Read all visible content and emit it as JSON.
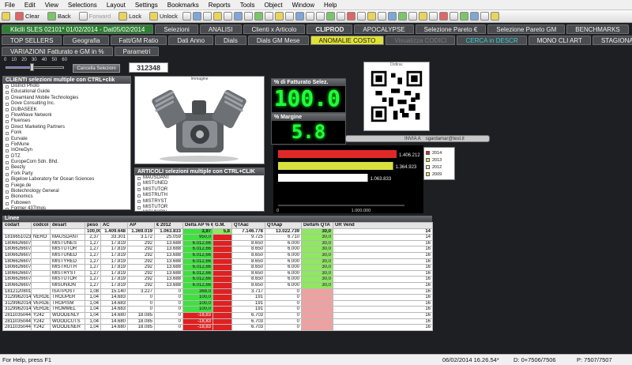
{
  "menu": [
    "File",
    "Edit",
    "View",
    "Selections",
    "Layout",
    "Settings",
    "Bookmarks",
    "Reports",
    "Tools",
    "Object",
    "Window",
    "Help"
  ],
  "toolbar": {
    "clear": "Clear",
    "back": "Back",
    "forward": "Forward",
    "lock": "Lock",
    "unlock": "Unlock"
  },
  "tabs_row1": [
    {
      "label": "Kliclli SLES 02101* 01/02/2014 - Dat05/02/2014",
      "style": "green"
    },
    {
      "label": "Selezioni",
      "style": ""
    },
    {
      "label": "ANALISI",
      "style": ""
    },
    {
      "label": "Clienti x Articolo",
      "style": ""
    },
    {
      "label": "CLIPROD",
      "style": "bold"
    },
    {
      "label": "APOCALYPSE",
      "style": ""
    },
    {
      "label": "Selezione Pareto €",
      "style": ""
    },
    {
      "label": "Selezione Pareto GM",
      "style": ""
    },
    {
      "label": "BENCHMARKS",
      "style": ""
    }
  ],
  "tabs_row2": [
    {
      "label": "TOP SELLERS",
      "style": ""
    },
    {
      "label": "Geografia",
      "style": ""
    },
    {
      "label": "Fatt/GM Ratio",
      "style": ""
    },
    {
      "label": "Dati Anno",
      "style": ""
    },
    {
      "label": "Dials",
      "style": ""
    },
    {
      "label": "Dials GM Mese",
      "style": ""
    },
    {
      "label": "ANOMALIE COSTO",
      "style": "yellow"
    },
    {
      "label": "Visualizza CODICI",
      "style": "dimtxt"
    },
    {
      "label": "CERCA in DESCR",
      "style": "cyan"
    },
    {
      "label": "MONO CLI ART",
      "style": ""
    },
    {
      "label": "STAGIONALITA",
      "style": ""
    }
  ],
  "tabs_row3": [
    {
      "label": "VARIAZIONI Fatturato e GM in  %",
      "style": ""
    },
    {
      "label": "Parametri",
      "style": ""
    }
  ],
  "slider": {
    "ticks": [
      "0",
      "10",
      "20",
      "30",
      "40",
      "50",
      "60"
    ],
    "value_pct": 45
  },
  "cancella_label": "Cancella Selezioni",
  "counter": "312348",
  "clienti": {
    "title": "CLIENTI selezioni multiple con CTRL+clik",
    "items": [
      "District Photo",
      "Educational Guide",
      "Dreamland Mobile Technologies",
      "Dove Consulting Inc.",
      "DUBASEEK",
      "FlowWave Network",
      "Fluenses",
      "Direct Marketing Partners",
      "Fonk",
      "Eurvate",
      "FixMune",
      "InOneDyn",
      "DTZ",
      "EuropeCom Sdn. Bhd.",
      "Beezly",
      "Fork Party",
      "Bigelow Laboratory for Ocean Sciences",
      "Fuege.de",
      "Biotechnology General",
      "Bionomics",
      "Fubowen",
      "Former 437Imgs"
    ]
  },
  "immagine_title": "Immagine",
  "articoli": {
    "title": "ARTICOLI selezioni multiple con CTRL+CLIK",
    "items": [
      "MAUSDANT",
      "MISTUNED",
      "MISTUTOR",
      "MISTRUTH",
      "MISTRYST",
      "MISTUTOR",
      "MISUNION"
    ]
  },
  "fatturato": {
    "title": "% di Fatturato Selez.",
    "value": "100.0"
  },
  "margine": {
    "title": "% Margine",
    "value": "5.8"
  },
  "qr_label": "Ordina:",
  "invia": {
    "label": "INVIA A",
    "value": "sgardamar@test.it"
  },
  "bar_chart": {
    "bars": [
      {
        "year": "2014",
        "value": 1406212,
        "label": "1.406.212",
        "color": "#e02828"
      },
      {
        "year": "2013",
        "value": 1364923,
        "label": "1.364.923",
        "color": "#d8e040"
      },
      {
        "year": "2012",
        "value": 1063833,
        "label": "1.063.833",
        "color": "#ffffff"
      }
    ],
    "legend": [
      {
        "year": "2014",
        "color": "#e02828"
      },
      {
        "year": "2013",
        "color": "#d8e040"
      },
      {
        "year": "2012",
        "color": "#f4f4b0"
      },
      {
        "year": "2009",
        "color": "#f0e068"
      }
    ],
    "axis": [
      "0",
      "1.000.000"
    ],
    "max": 1500000
  },
  "linee_title": "Linee",
  "table": {
    "headers": [
      "codart",
      "codcol",
      "desart",
      "peso",
      "AC",
      "AP",
      "€ 2012",
      "Delta AP % €",
      "G.M.",
      "QTAac",
      "QTAap",
      "Delta% QTA",
      "UR Vend"
    ],
    "total": [
      "",
      "",
      "",
      "100,00",
      "1.409.648",
      "1.369.019",
      "1.063.833",
      "3,97",
      "5,8",
      "7.146.778",
      "13.022.739",
      "30,0",
      "14"
    ],
    "rows": [
      [
        "1816651023",
        "NERO",
        "MAUSDANT",
        "2,37",
        "33.301",
        "3.172",
        "25.059",
        "950,0",
        "",
        "9.725",
        "6.710",
        "30,0",
        "14"
      ],
      [
        "1806626607",
        "",
        "MISTUNES",
        "1,27",
        "17.819",
        "292",
        "13.688",
        "6.012,66",
        "",
        "8.650",
        "6.000",
        "30,0",
        "16"
      ],
      [
        "1806626607",
        "",
        "MISTUTOR",
        "1,27",
        "17.819",
        "292",
        "13.688",
        "6.012,66",
        "",
        "8.650",
        "6.000",
        "30,0",
        "16"
      ],
      [
        "1806626607",
        "",
        "MISTUNED",
        "1,27",
        "17.819",
        "292",
        "13.688",
        "6.012,66",
        "",
        "8.650",
        "6.000",
        "30,0",
        "16"
      ],
      [
        "1806626607",
        "",
        "MISTYRED",
        "1,27",
        "17.819",
        "292",
        "13.688",
        "6.012,66",
        "",
        "8.650",
        "6.000",
        "30,0",
        "16"
      ],
      [
        "1806626607",
        "",
        "MISTRUTH",
        "1,27",
        "17.819",
        "292",
        "13.688",
        "6.012,66",
        "",
        "8.650",
        "6.000",
        "30,0",
        "16"
      ],
      [
        "1806626607",
        "",
        "MISTRYST",
        "1,27",
        "17.819",
        "292",
        "13.688",
        "6.012,66",
        "",
        "8.650",
        "6.000",
        "30,0",
        "16"
      ],
      [
        "1806626607",
        "",
        "MISTUTOR",
        "1,27",
        "17.819",
        "292",
        "13.688",
        "6.012,66",
        "",
        "8.650",
        "6.000",
        "30,0",
        "16"
      ],
      [
        "1806626607",
        "",
        "MISUNION",
        "1,27",
        "17.819",
        "292",
        "13.688",
        "6.012,66",
        "",
        "8.650",
        "6.000",
        "30,0",
        "16"
      ],
      [
        "1812120801",
        "",
        "ISATPOST",
        "1,08",
        "15.140",
        "3.227",
        "0",
        "369,0",
        "",
        "3.717",
        "0",
        "",
        "16"
      ],
      [
        "3129962014",
        "VERDE",
        "TROUPER",
        "1,04",
        "14.683",
        "0",
        "0",
        "100,0",
        "",
        "191",
        "0",
        "",
        "16"
      ],
      [
        "3129962014",
        "VERDE",
        "TROPISM",
        "1,04",
        "14.683",
        "0",
        "0",
        "100,0",
        "",
        "191",
        "0",
        "",
        "16"
      ],
      [
        "3129962014",
        "VERDE",
        "TROMMEL",
        "1,04",
        "14.683",
        "0",
        "0",
        "100,0",
        "",
        "191",
        "0",
        "",
        "16"
      ],
      [
        "2811035044",
        "Y242",
        "WOODENLY",
        "1,04",
        "14.680",
        "18.085",
        "0",
        "-18,83",
        "",
        "6.703",
        "0",
        "",
        "16"
      ],
      [
        "2811035044",
        "Y242",
        "WOODCUTS",
        "1,04",
        "14.680",
        "18.085",
        "0",
        "-18,83",
        "",
        "6.703",
        "0",
        "",
        "16"
      ],
      [
        "2811035044",
        "Y242",
        "WOODENER",
        "1,04",
        "14.680",
        "18.085",
        "0",
        "-18,83",
        "",
        "6.703",
        "0",
        "",
        "16"
      ]
    ]
  },
  "status": {
    "help": "For Help, press F1",
    "datetime": "06/02/2014 16.26.54*",
    "d": "D: 0+7506/7506",
    "p": "P: 7507/7507"
  }
}
